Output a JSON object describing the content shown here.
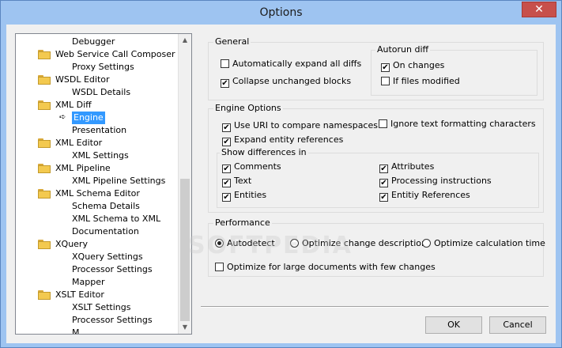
{
  "window": {
    "title": "Options",
    "close_label": "✕"
  },
  "tree": {
    "items": [
      {
        "label": "Debugger",
        "level": 1
      },
      {
        "label": "Web Service Call Composer",
        "level": 0
      },
      {
        "label": "Proxy Settings",
        "level": 1
      },
      {
        "label": "WSDL Editor",
        "level": 0
      },
      {
        "label": "WSDL Details",
        "level": 1
      },
      {
        "label": "XML Diff",
        "level": 0
      },
      {
        "label": "Engine",
        "level": 1,
        "selected": true
      },
      {
        "label": "Presentation",
        "level": 1
      },
      {
        "label": "XML Editor",
        "level": 0
      },
      {
        "label": "XML Settings",
        "level": 1
      },
      {
        "label": "XML Pipeline",
        "level": 0
      },
      {
        "label": "XML Pipeline Settings",
        "level": 1
      },
      {
        "label": "XML Schema Editor",
        "level": 0
      },
      {
        "label": "Schema Details",
        "level": 1
      },
      {
        "label": "XML Schema to XML",
        "level": 1
      },
      {
        "label": "Documentation",
        "level": 1
      },
      {
        "label": "XQuery",
        "level": 0
      },
      {
        "label": "XQuery Settings",
        "level": 1
      },
      {
        "label": "Processor Settings",
        "level": 1
      },
      {
        "label": "Mapper",
        "level": 1
      },
      {
        "label": "XSLT Editor",
        "level": 0
      },
      {
        "label": "XSLT Settings",
        "level": 1
      },
      {
        "label": "Processor Settings",
        "level": 1
      },
      {
        "label": "M...",
        "level": 1
      }
    ]
  },
  "general": {
    "label": "General",
    "expand_all": {
      "label": "Automatically expand all diffs",
      "checked": false
    },
    "collapse": {
      "label": "Collapse unchanged blocks",
      "checked": true
    },
    "autorun": {
      "label": "Autorun diff",
      "on_changes": {
        "label": "On changes",
        "checked": true
      },
      "if_modified": {
        "label": "If files modified",
        "checked": false
      }
    }
  },
  "engine": {
    "label": "Engine Options",
    "use_uri": {
      "label": "Use URI to compare namespaces",
      "checked": true
    },
    "ignore_text": {
      "label": "Ignore text formatting characters",
      "checked": false
    },
    "expand_entity": {
      "label": "Expand entity references",
      "checked": true
    },
    "show_diff": {
      "label": "Show differences in",
      "comments": {
        "label": "Comments",
        "checked": true
      },
      "attributes": {
        "label": "Attributes",
        "checked": true
      },
      "text": {
        "label": "Text",
        "checked": true
      },
      "processing": {
        "label": "Processing instructions",
        "checked": true
      },
      "entities": {
        "label": "Entities",
        "checked": true
      },
      "entity_refs": {
        "label": "Entitiy References",
        "checked": true
      }
    }
  },
  "performance": {
    "label": "Performance",
    "autodetect": {
      "label": "Autodetect",
      "selected": true
    },
    "opt_change": {
      "label": "Optimize change description",
      "selected": false
    },
    "opt_calc": {
      "label": "Optimize calculation time",
      "selected": false
    },
    "large_docs": {
      "label": "Optimize for large documents with few changes",
      "checked": false
    }
  },
  "buttons": {
    "ok": "OK",
    "cancel": "Cancel"
  },
  "watermark": "SOFTPEDIA"
}
